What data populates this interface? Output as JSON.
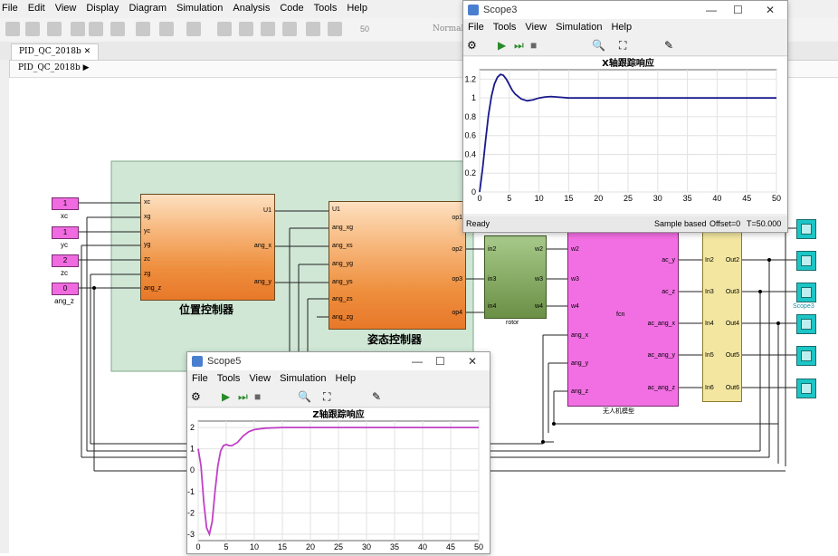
{
  "menubar": {
    "items": [
      "File",
      "Edit",
      "View",
      "Display",
      "Diagram",
      "Simulation",
      "Analysis",
      "Code",
      "Tools",
      "Help"
    ]
  },
  "toolbar": {
    "stop_time": "50",
    "mode": "Normal"
  },
  "tab": {
    "label": "PID_QC_2018b"
  },
  "breadcrumb": {
    "label": "PID_QC_2018b"
  },
  "inports": [
    {
      "num": "1",
      "label": "xc"
    },
    {
      "num": "1",
      "label": "yc"
    },
    {
      "num": "2",
      "label": "zc"
    },
    {
      "num": "0",
      "label": "ang_z"
    }
  ],
  "position_block": {
    "title": "位置控制器",
    "in_ports": [
      "xc",
      "xg",
      "yc",
      "yg",
      "zc",
      "zg",
      "ang_z"
    ],
    "out_ports": [
      "U1",
      "ang_x",
      "ang_y"
    ]
  },
  "attitude_block": {
    "title": "姿态控制器",
    "in_ports": [
      "U1",
      "ang_xg",
      "ang_xs",
      "ang_yg",
      "ang_ys",
      "ang_zs",
      "ang_zg"
    ],
    "out_ports": [
      "op1",
      "op2",
      "op3",
      "op4"
    ]
  },
  "rotor_block": {
    "label": "rotor",
    "in_ports": [
      "in2",
      "in3",
      "in4"
    ],
    "out_ports": [
      "w2",
      "w3",
      "w4"
    ]
  },
  "uav_block": {
    "label": "无人机模型",
    "fcn": "fcn",
    "in_ports": [
      "w2",
      "w3",
      "w4",
      "ang_x",
      "ang_y",
      "ang_z"
    ],
    "out_ports": [
      "ac_y",
      "ac_z",
      "ac_ang_x",
      "ac_ang_y",
      "ac_ang_z"
    ]
  },
  "mux_block": {
    "in_ports": [
      "In2",
      "In3",
      "In4",
      "In5",
      "In6"
    ],
    "out_ports": [
      "Out2",
      "Out3",
      "Out4",
      "Out5",
      "Out6"
    ]
  },
  "scope_label": "Scope3",
  "scope3": {
    "title": "Scope3",
    "menu": [
      "File",
      "Tools",
      "View",
      "Simulation",
      "Help"
    ],
    "status": {
      "left": "Ready",
      "sample": "Sample based",
      "offset": "Offset=0",
      "time": "T=50.000"
    }
  },
  "scope5": {
    "title": "Scope5",
    "menu": [
      "File",
      "Tools",
      "View",
      "Simulation",
      "Help"
    ]
  },
  "chart_data": [
    {
      "type": "line",
      "title": "X轴跟踪响应",
      "xlabel": "",
      "ylabel": "",
      "xlim": [
        0,
        50
      ],
      "ylim": [
        0,
        1.3
      ],
      "xticks": [
        0,
        5,
        10,
        15,
        20,
        25,
        30,
        35,
        40,
        45,
        50
      ],
      "yticks": [
        0,
        0.2,
        0.4,
        0.6,
        0.8,
        1,
        1.2
      ],
      "ytick_labels": [
        "0",
        "0.2",
        "0.4",
        "0.6",
        "0.8",
        "1",
        "1.2"
      ],
      "grid": true,
      "color": "#1a1a8c",
      "x": [
        0,
        0.5,
        1,
        1.5,
        2,
        2.5,
        3,
        3.5,
        4,
        4.5,
        5,
        5.5,
        6,
        7,
        8,
        9,
        10,
        11,
        12,
        13,
        14,
        15,
        17,
        20,
        25,
        30,
        35,
        40,
        45,
        50
      ],
      "y": [
        0,
        0.25,
        0.55,
        0.82,
        1.02,
        1.15,
        1.22,
        1.25,
        1.24,
        1.2,
        1.14,
        1.08,
        1.04,
        0.99,
        0.97,
        0.98,
        1.0,
        1.01,
        1.015,
        1.01,
        1.005,
        1.0,
        1.0,
        1.0,
        1.0,
        1.0,
        1.0,
        1.0,
        1.0,
        1.0
      ]
    },
    {
      "type": "line",
      "title": "Z轴跟踪响应",
      "xlabel": "",
      "ylabel": "",
      "xlim": [
        0,
        50
      ],
      "ylim": [
        -3.3,
        2.3
      ],
      "xticks": [
        0,
        5,
        10,
        15,
        20,
        25,
        30,
        35,
        40,
        45,
        50
      ],
      "yticks": [
        -3,
        -2,
        -1,
        0,
        1,
        2
      ],
      "ytick_labels": [
        "-3",
        "-2",
        "-1",
        "0",
        "1",
        "2"
      ],
      "grid": true,
      "color": "#c040c8",
      "x": [
        0,
        0.5,
        1,
        1.5,
        2,
        2.5,
        3,
        3.5,
        4,
        4.5,
        5,
        5.5,
        6,
        7,
        8,
        9,
        10,
        12,
        15,
        20,
        25,
        30,
        35,
        40,
        45,
        50
      ],
      "y": [
        1,
        0.2,
        -1.5,
        -2.7,
        -3.0,
        -2.4,
        -1.0,
        0.2,
        0.9,
        1.15,
        1.2,
        1.15,
        1.15,
        1.3,
        1.6,
        1.8,
        1.9,
        1.97,
        2.0,
        2.0,
        2.0,
        2.0,
        2.0,
        2.0,
        2.0,
        2.0
      ]
    }
  ]
}
